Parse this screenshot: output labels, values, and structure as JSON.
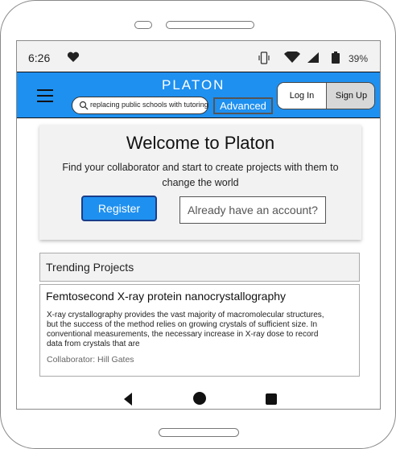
{
  "status_bar": {
    "time": "6:26",
    "battery_percent": "39%",
    "icons": [
      "heart-icon",
      "vibrate-icon",
      "wifi-icon",
      "signal-icon",
      "battery-icon"
    ]
  },
  "app_bar": {
    "brand": "PLATON",
    "search": {
      "value": "replacing public schools with tutoring"
    },
    "advanced_label": "Advanced",
    "login_label": "Log In",
    "signup_label": "Sign Up",
    "accent_color": "#1e90f0"
  },
  "welcome": {
    "title": "Welcome to Platon",
    "subtitle": "Find your collaborator and start to create projects with them to change the world",
    "register_label": "Register",
    "have_account_label": "Already have an account?"
  },
  "trending": {
    "heading": "Trending Projects",
    "projects": [
      {
        "title": "Femtosecond X-ray protein nanocrystallography",
        "description": "X-ray crystallography provides the vast majority of macromolecular structures, but the success of the method relies on growing crystals of sufficient size. In conventional measurements, the necessary increase in X-ray dose to record data from crystals that are",
        "collaborator": "Collaborator: Hill Gates"
      }
    ]
  },
  "nav": {
    "icons": [
      "back-icon",
      "home-icon",
      "recents-icon"
    ]
  }
}
